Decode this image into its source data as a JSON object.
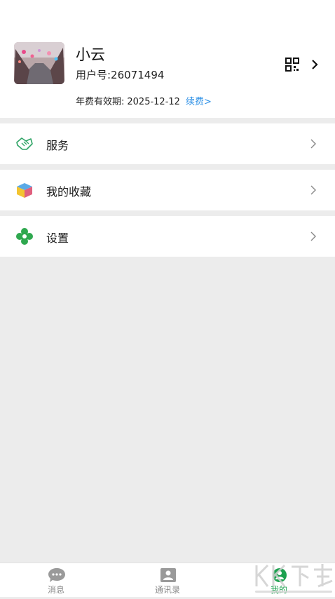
{
  "profile": {
    "nickname": "小云",
    "user_id": "用户号:26071494",
    "fee_label": "年费有效期:",
    "fee_date": "2025-12-12",
    "renew_link": "续费>"
  },
  "menu": [
    {
      "label": "服务",
      "icon": "handshake-icon"
    },
    {
      "label": "我的收藏",
      "icon": "cube-icon"
    },
    {
      "label": "设置",
      "icon": "gear-flower-icon"
    }
  ],
  "tabbar": {
    "tabs": [
      {
        "label": "消息",
        "icon": "chat-bubble-icon",
        "active": false
      },
      {
        "label": "通讯录",
        "icon": "contacts-icon",
        "active": false
      },
      {
        "label": "我的",
        "icon": "profile-icon",
        "active": true
      }
    ]
  },
  "colors": {
    "accent_green": "#1ca14f",
    "link_blue": "#2b8fe6",
    "background": "#ececec"
  }
}
